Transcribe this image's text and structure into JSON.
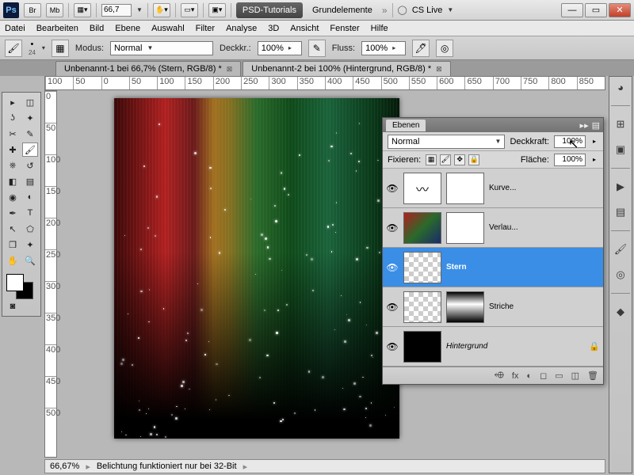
{
  "titlebar": {
    "app": "Ps",
    "zoom": "66,7",
    "workspace_pill": "PSD-Tutorials",
    "workspace_text": "Grundelemente",
    "cslive": "CS Live"
  },
  "menu": [
    "Datei",
    "Bearbeiten",
    "Bild",
    "Ebene",
    "Auswahl",
    "Filter",
    "Analyse",
    "3D",
    "Ansicht",
    "Fenster",
    "Hilfe"
  ],
  "options": {
    "brush_size": "24",
    "mode_label": "Modus:",
    "mode_value": "Normal",
    "opacity_label": "Deckkr.:",
    "opacity_value": "100%",
    "flow_label": "Fluss:",
    "flow_value": "100%"
  },
  "tabs": [
    "Unbenannt-1 bei 66,7% (Stern, RGB/8) *",
    "Unbenannt-2 bei 100% (Hintergrund, RGB/8) *"
  ],
  "ruler_h": [
    "100",
    "50",
    "0",
    "50",
    "100",
    "150",
    "200",
    "250",
    "300",
    "350",
    "400",
    "450",
    "500",
    "550",
    "600",
    "650",
    "700",
    "750",
    "800",
    "850"
  ],
  "ruler_v": [
    "0",
    "50",
    "100",
    "150",
    "200",
    "250",
    "300",
    "350",
    "400",
    "450",
    "500"
  ],
  "layers_panel": {
    "tab": "Ebenen",
    "blend_mode": "Normal",
    "opacity_label": "Deckkraft:",
    "opacity_value": "100%",
    "lock_label": "Fixieren:",
    "fill_label": "Fläche:",
    "fill_value": "100%",
    "layers": [
      {
        "name": "Kurve...",
        "thumb": "adj-curve",
        "mask": "mask",
        "selected": false
      },
      {
        "name": "Verlau...",
        "thumb": "adj-grad",
        "mask": "mask",
        "selected": false
      },
      {
        "name": "Stern",
        "thumb": "checker",
        "mask": "",
        "selected": true,
        "bold": true
      },
      {
        "name": "Striche",
        "thumb": "checker-v",
        "mask": "mask-stripes",
        "selected": false
      },
      {
        "name": "Hintergrund",
        "thumb": "black",
        "mask": "",
        "selected": false,
        "italic": true,
        "locked": true
      }
    ],
    "footer_icons": [
      "⬲",
      "fx",
      "◐",
      "◻",
      "▭",
      "◫",
      "🗑"
    ]
  },
  "status": {
    "zoom": "66,67%",
    "info": "Belichtung funktioniert nur bei 32-Bit"
  }
}
